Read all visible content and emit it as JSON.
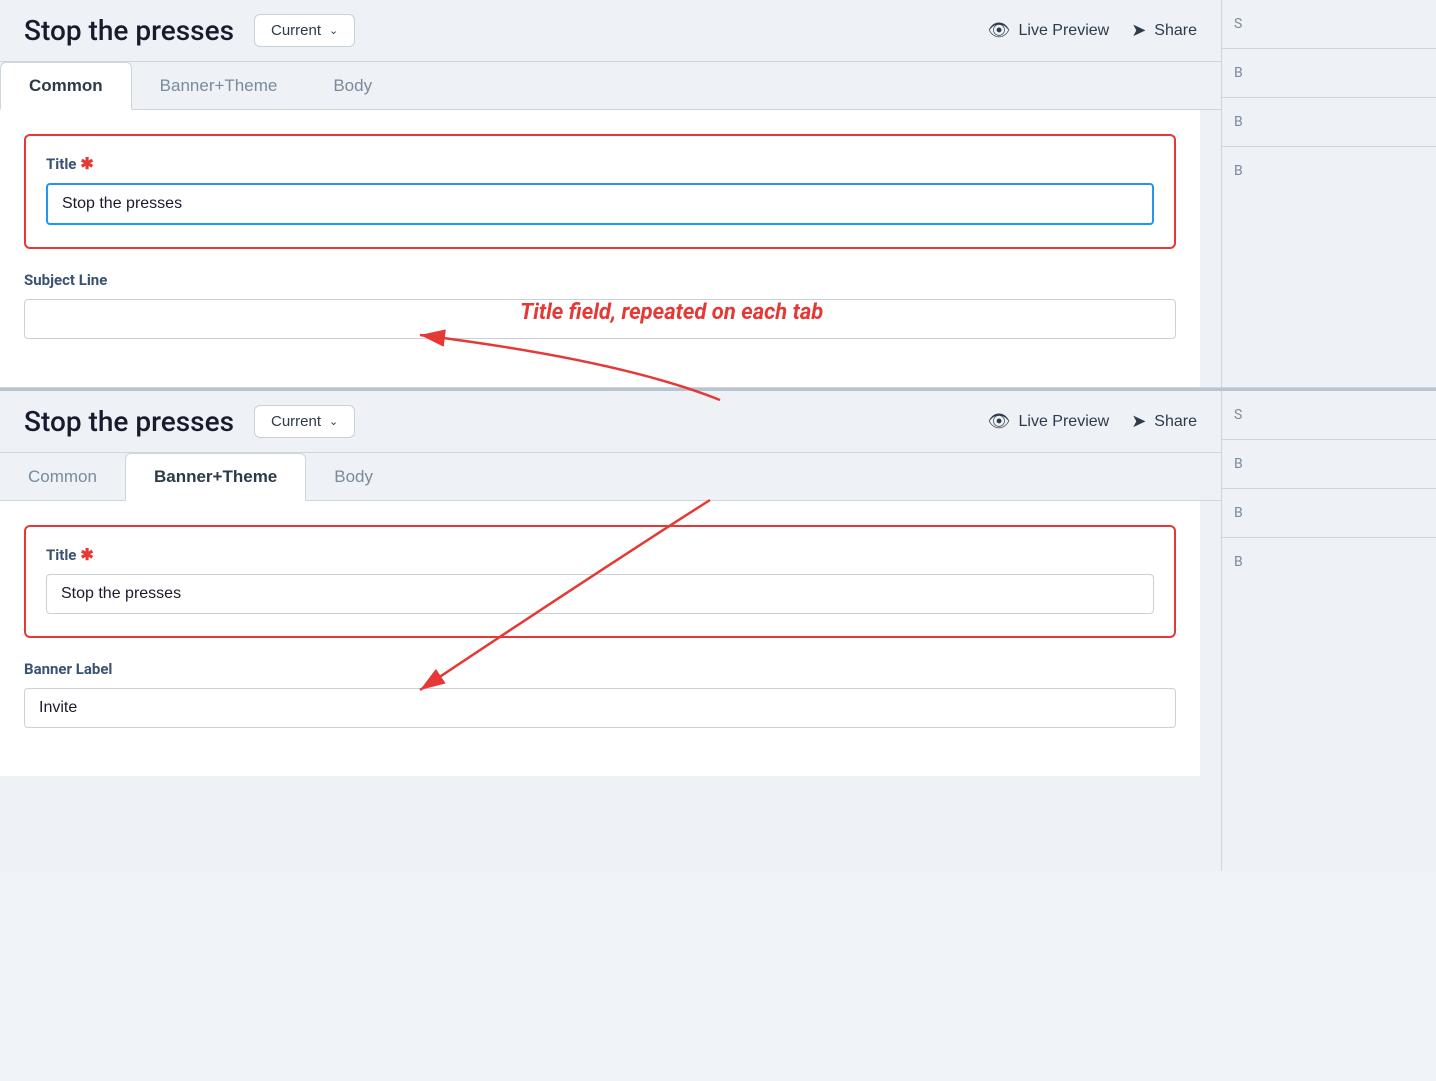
{
  "panel1": {
    "title": "Stop the presses",
    "version_label": "Current",
    "live_preview_label": "Live Preview",
    "share_label": "Share",
    "tabs": [
      {
        "id": "common",
        "label": "Common",
        "active": true
      },
      {
        "id": "banner_theme",
        "label": "Banner+Theme",
        "active": false
      },
      {
        "id": "body",
        "label": "Body",
        "active": false
      }
    ],
    "title_field": {
      "label": "Title",
      "required": true,
      "value": "Stop the presses",
      "focused": true
    },
    "subject_line_field": {
      "label": "Subject Line",
      "required": false,
      "value": ""
    }
  },
  "annotation": {
    "text": "Title field, repeated on each tab"
  },
  "panel2": {
    "title": "Stop the presses",
    "version_label": "Current",
    "live_preview_label": "Live Preview",
    "share_label": "Share",
    "tabs": [
      {
        "id": "common",
        "label": "Common",
        "active": false
      },
      {
        "id": "banner_theme",
        "label": "Banner+Theme",
        "active": true
      },
      {
        "id": "body",
        "label": "Body",
        "active": false
      }
    ],
    "title_field": {
      "label": "Title",
      "required": true,
      "value": "Stop the presses"
    },
    "banner_label_field": {
      "label": "Banner Label",
      "required": false,
      "value": "Invite"
    }
  },
  "right_col": {
    "labels": [
      "S",
      "B",
      "B",
      "B"
    ]
  }
}
